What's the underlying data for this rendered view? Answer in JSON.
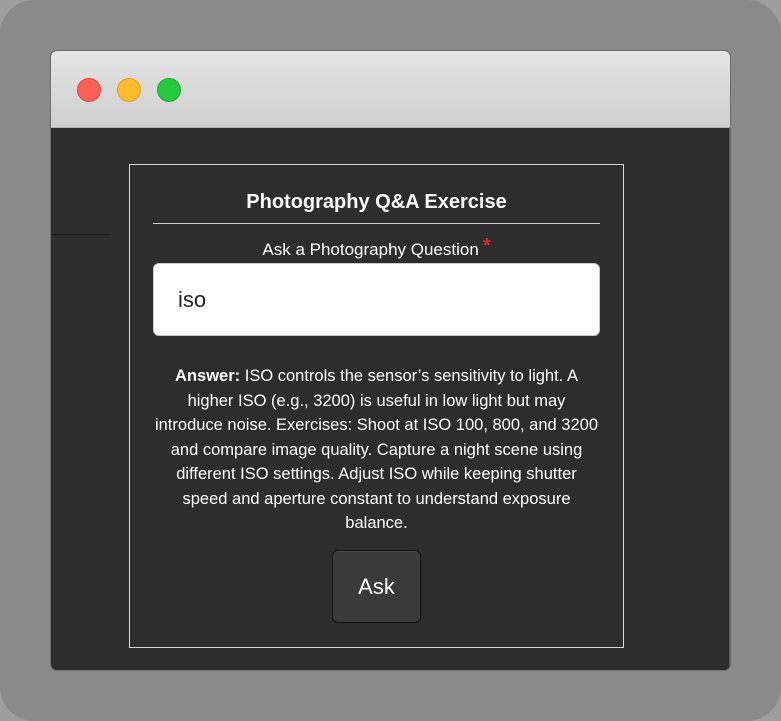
{
  "window": {
    "traffic_lights": [
      "close",
      "minimize",
      "zoom"
    ]
  },
  "form": {
    "title": "Photography Q&A Exercise",
    "question_label": "Ask a Photography Question",
    "required_mark": "*",
    "question_value": "iso",
    "answer_label": "Answer:",
    "answer_text": " ISO controls the sensor’s sensitivity to light. A higher ISO (e.g., 3200) is useful in low light but may introduce noise. Exercises: Shoot at ISO 100, 800, and 3200 and compare image quality. Capture a night scene using different ISO settings. Adjust ISO while keeping shutter speed and aperture constant to understand exposure balance.",
    "ask_button_label": "Ask"
  },
  "colors": {
    "window_bg": "#2d2d2d",
    "titlebar_bg": "#d9d9d9",
    "close": "#fe5f57",
    "minimize": "#febc2e",
    "zoom": "#28c840",
    "required": "#e22424",
    "text": "#ffffff"
  }
}
